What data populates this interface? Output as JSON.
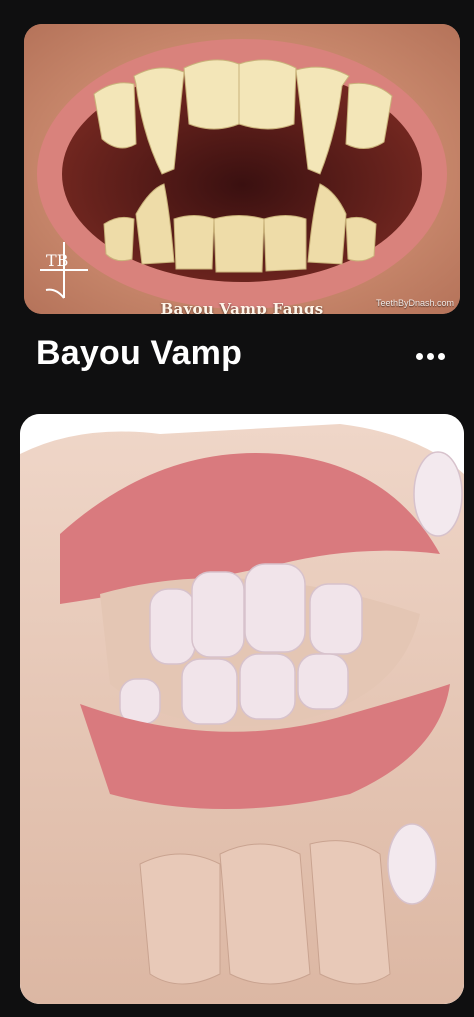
{
  "pin_top": {
    "caption": "Bayou Vamp Fangs",
    "watermark": "TeethByDnash.com",
    "logo_text": "TB",
    "image_subject": "vampire-fangs-photo"
  },
  "pin_title": "Bayou Vamp",
  "more_button": {
    "icon": "ellipsis-horizontal-icon"
  },
  "pin_bottom": {
    "image_subject": "hands-mouth-nails-photo"
  },
  "colors": {
    "background": "#0f0f10",
    "text": "#ffffff",
    "lip": "#d9827c",
    "tooth": "#f3e6b8",
    "nail": "#f1e4ea"
  }
}
